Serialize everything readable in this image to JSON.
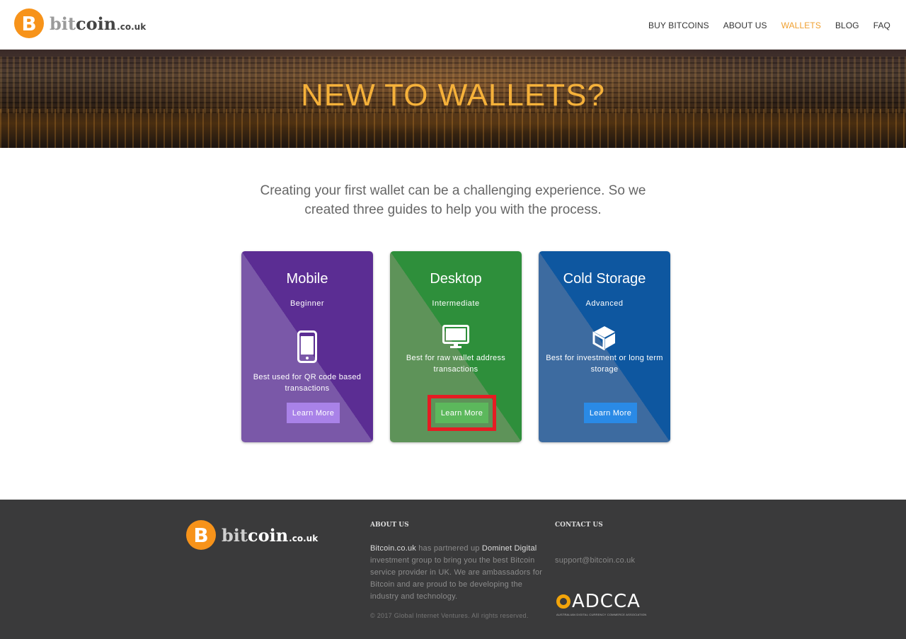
{
  "header": {
    "logo": {
      "coin_glyph": "B",
      "bit": "bit",
      "coin": "coin",
      "tld": ".co.uk"
    },
    "nav": [
      {
        "label": "BUY BITCOINS",
        "active": false
      },
      {
        "label": "ABOUT US",
        "active": false
      },
      {
        "label": "WALLETS",
        "active": true
      },
      {
        "label": "BLOG",
        "active": false
      },
      {
        "label": "FAQ",
        "active": false
      }
    ]
  },
  "hero": {
    "title": "NEW TO WALLETS?"
  },
  "intro": {
    "text": "Creating your first wallet can be a challenging experience. So we created three guides to help you with the process."
  },
  "cards": [
    {
      "title": "Mobile",
      "level": "Beginner",
      "icon": "smartphone-icon",
      "desc": "Best used for QR code based transactions",
      "button": "Learn More",
      "color": "#5b2d93"
    },
    {
      "title": "Desktop",
      "level": "Intermediate",
      "icon": "monitor-icon",
      "desc": "Best for raw wallet address transactions",
      "button": "Learn More",
      "color": "#2e8f3b",
      "highlighted": true
    },
    {
      "title": "Cold Storage",
      "level": "Advanced",
      "icon": "cube-icon",
      "desc": "Best for investment or long term storage",
      "button": "Learn More",
      "color": "#0e57a0"
    }
  ],
  "footer": {
    "logo": {
      "coin_glyph": "B",
      "bit": "bit",
      "coin": "coin",
      "tld": ".co.uk"
    },
    "about_heading": "ABOUT US",
    "about_brand": "Bitcoin.co.uk",
    "about_t1": " has partnered up ",
    "about_partner": "Dominet Digital",
    "about_t2": " investment group to bring you the best Bitcoin service provider in UK. We are ambassadors for Bitcoin and are proud to be developing the industry and technology.",
    "copyright": "© 2017 Global Internet Ventures. All rights reserved.",
    "contact_heading": "CONTACT US",
    "email": "support@bitcoin.co.uk",
    "adcca": {
      "name": "ADCCA",
      "tagline": "AUSTRALIAN DIGITAL CURRENCY COMMERCE ASSOCIATION"
    }
  },
  "colors": {
    "accent": "#f7931a",
    "nav_active": "#f0a030",
    "highlight": "#e51c23",
    "footer_bg": "#3a3a3b"
  }
}
